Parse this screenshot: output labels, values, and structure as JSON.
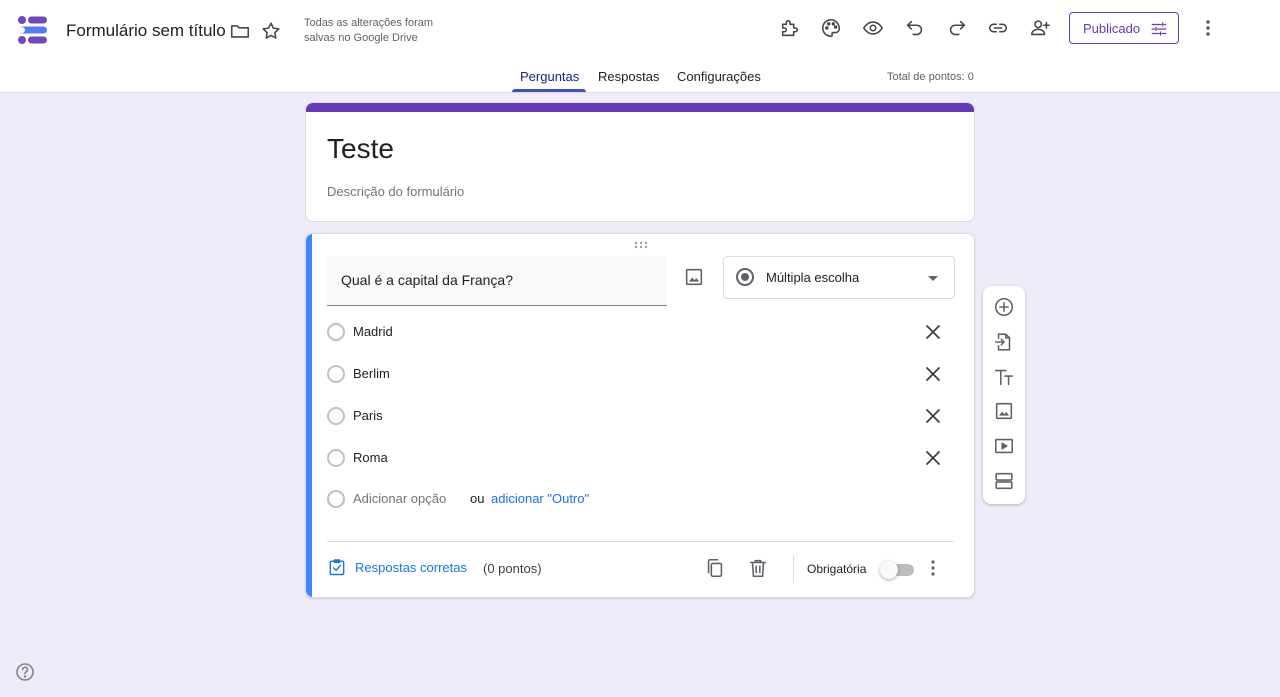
{
  "app": {
    "doc_title": "Formulário sem título",
    "save_status": "Todas as alterações foram salvas no Google Drive",
    "publish_label": "Publicado",
    "colors": {
      "accent": "#673ab7",
      "tab_active": "#3f51b5",
      "question_bar": "#4285f4",
      "link": "#1a73e8",
      "page_bg": "#f0ebf8"
    }
  },
  "tabs": [
    {
      "label": "Perguntas",
      "active": true
    },
    {
      "label": "Respostas",
      "active": false
    },
    {
      "label": "Configurações",
      "active": false
    }
  ],
  "points_total": "Total de pontos: 0",
  "form": {
    "title": "Teste",
    "description": "Descrição do formulário"
  },
  "question": {
    "text": "Qual é a capital da França?",
    "type": "Múltipla escolha",
    "options": [
      "Madrid",
      "Berlim",
      "Paris",
      "Roma"
    ],
    "add_option": "Adicionar opção",
    "or": "ou",
    "add_other": "adicionar \"Outro\"",
    "answer_key": "Respostas corretas",
    "points": "(0 pontos)",
    "required_label": "Obrigatória",
    "required": false
  },
  "icons": {
    "header": [
      "forms-logo",
      "folder-icon",
      "star-icon",
      "addon-icon",
      "palette-icon",
      "preview-icon",
      "undo-icon",
      "redo-icon",
      "link-icon",
      "add-collaborator-icon",
      "tune-icon",
      "more-vert-icon"
    ],
    "toolbar": [
      "add-question-icon",
      "import-questions-icon",
      "add-title-icon",
      "add-image-icon",
      "add-video-icon",
      "add-section-icon"
    ]
  }
}
